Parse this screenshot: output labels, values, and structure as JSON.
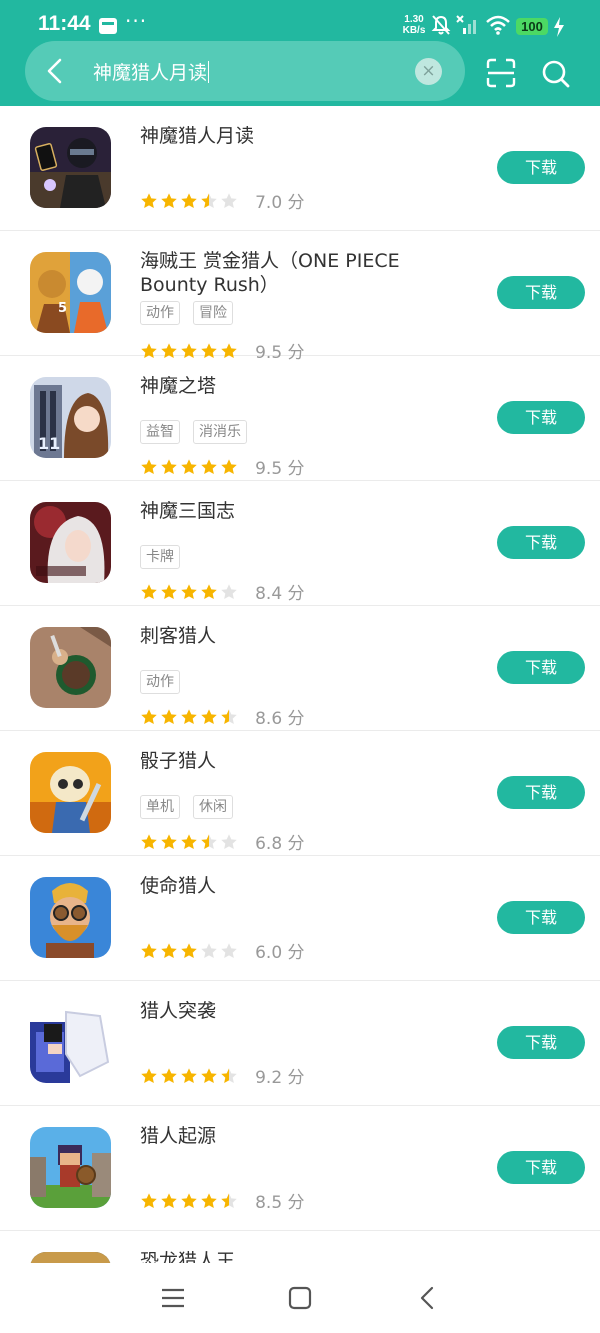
{
  "status": {
    "time": "11:44",
    "dots": "···",
    "net_speed_value": "1.30",
    "net_speed_unit": "KB/s",
    "battery": "100"
  },
  "search": {
    "query": "神魔猎人月读"
  },
  "download_label": "下载",
  "score_unit": "分",
  "colors": {
    "accent": "#22b8a0",
    "star": "#f7b500",
    "star_empty": "#e3e3e3"
  },
  "results": [
    {
      "name": "神魔猎人月读",
      "tags": [],
      "stars": 3.5,
      "score": "7.0",
      "icon": "masked-card-warrior-icon"
    },
    {
      "name": "海贼王 赏金猎人（ONE PIECE Bounty Rush）",
      "tags": [
        "动作",
        "冒险"
      ],
      "stars": 5,
      "score": "9.5",
      "icon": "pirate-fighters-icon"
    },
    {
      "name": "神魔之塔",
      "tags": [
        "益智",
        "消消乐"
      ],
      "stars": 5,
      "score": "9.5",
      "icon": "anime-girl-tower-icon"
    },
    {
      "name": "神魔三国志",
      "tags": [
        "卡牌"
      ],
      "stars": 4,
      "score": "8.4",
      "icon": "white-haired-heroine-icon"
    },
    {
      "name": "刺客猎人",
      "tags": [
        "动作"
      ],
      "stars": 4.5,
      "score": "8.6",
      "icon": "assassin-topdown-icon"
    },
    {
      "name": "骰子猎人",
      "tags": [
        "单机",
        "休闲"
      ],
      "stars": 3.5,
      "score": "6.8",
      "icon": "dice-knight-icon"
    },
    {
      "name": "使命猎人",
      "tags": [],
      "stars": 3,
      "score": "6.0",
      "icon": "goggled-hunter-icon"
    },
    {
      "name": "猎人突袭",
      "tags": [],
      "stars": 4.5,
      "score": "9.2",
      "icon": "pixel-beast-icon"
    },
    {
      "name": "猎人起源",
      "tags": [],
      "stars": 4.5,
      "score": "8.5",
      "icon": "voxel-hero-icon"
    },
    {
      "name": "恐龙猎人王",
      "tags": [],
      "stars": null,
      "score": null,
      "icon": "dinosaur-hunter-icon"
    }
  ]
}
